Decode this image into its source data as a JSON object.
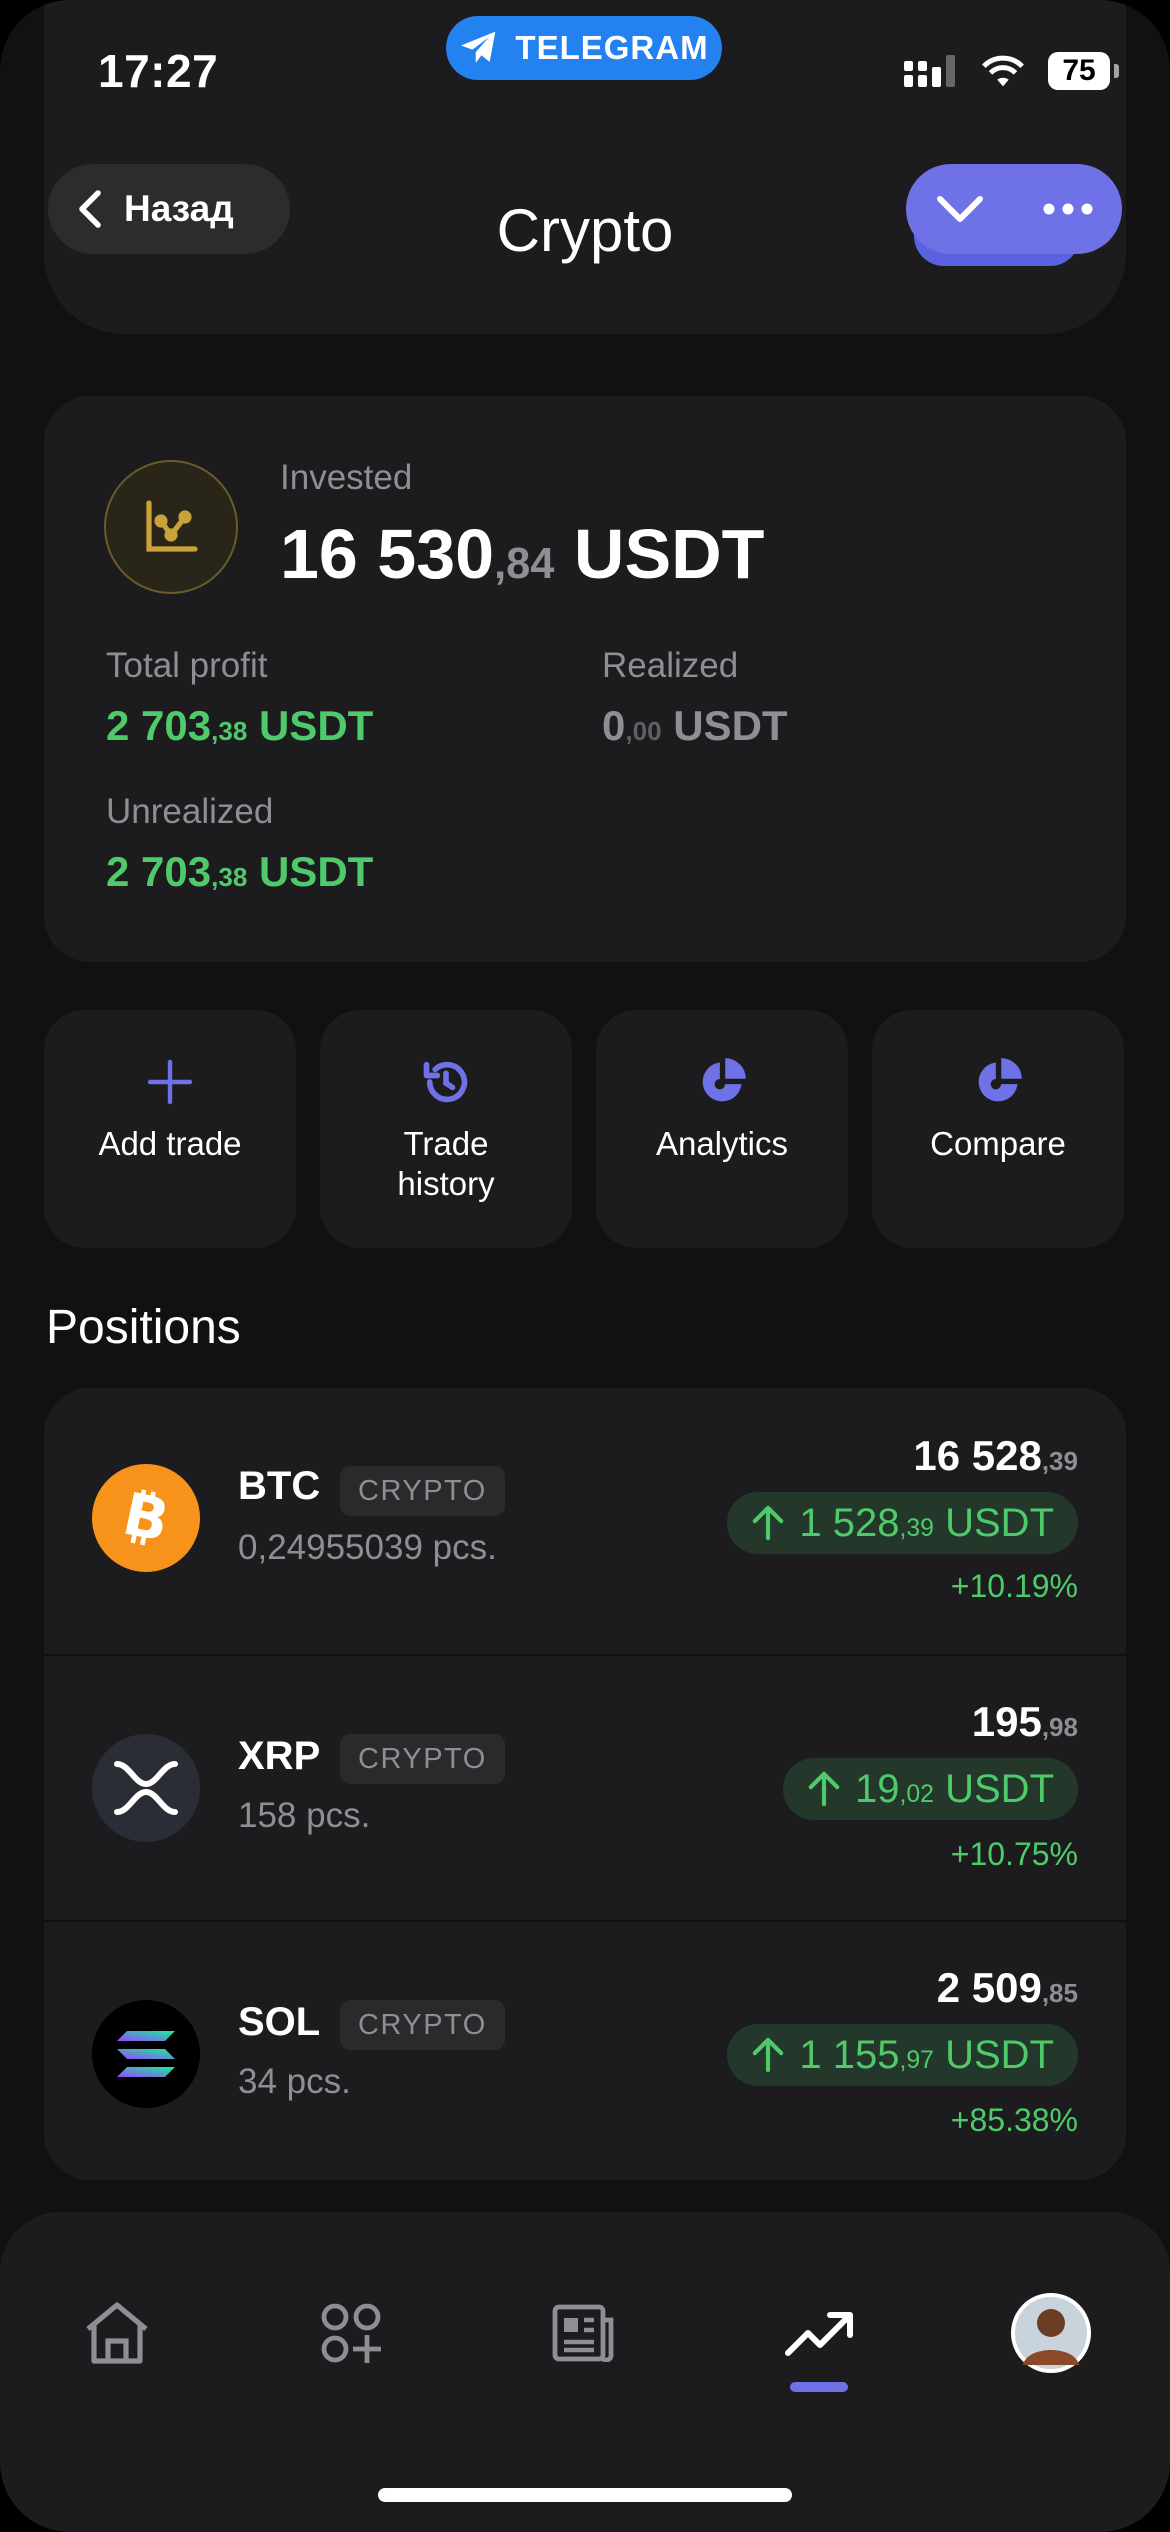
{
  "status_bar": {
    "time": "17:27",
    "battery": "75",
    "telegram_label": "TELEGRAM"
  },
  "header": {
    "back_label": "Назад",
    "title": "Crypto"
  },
  "invested": {
    "label": "Invested",
    "value_int": "16 530",
    "value_dec": ",84",
    "currency": "USDT",
    "total_profit": {
      "label": "Total profit",
      "int": "2 703",
      "dec": ",38",
      "currency": "USDT"
    },
    "realized": {
      "label": "Realized",
      "int": "0",
      "dec": ",00",
      "currency": "USDT"
    },
    "unrealized": {
      "label": "Unrealized",
      "int": "2 703",
      "dec": ",38",
      "currency": "USDT"
    }
  },
  "actions": [
    {
      "label": "Add trade",
      "icon": "plus-icon"
    },
    {
      "label": "Trade\nhistory",
      "icon": "history-icon"
    },
    {
      "label": "Analytics",
      "icon": "pie-chart-icon"
    },
    {
      "label": "Compare",
      "icon": "pie-chart-icon"
    }
  ],
  "positions_title": "Positions",
  "positions": [
    {
      "ticker": "BTC",
      "badge": "CRYPTO",
      "qty": "0,24955039 pcs.",
      "price_int": "16 528",
      "price_dec": ",39",
      "gain_int": "1 528",
      "gain_dec": ",39",
      "gain_currency": "USDT",
      "pct": "+10.19%"
    },
    {
      "ticker": "XRP",
      "badge": "CRYPTO",
      "qty": "158 pcs.",
      "price_int": "195",
      "price_dec": ",98",
      "gain_int": "19",
      "gain_dec": ",02",
      "gain_currency": "USDT",
      "pct": "+10.75%"
    },
    {
      "ticker": "SOL",
      "badge": "CRYPTO",
      "qty": "34 pcs.",
      "price_int": "2 509",
      "price_dec": ",85",
      "gain_int": "1 155",
      "gain_dec": ",97",
      "gain_currency": "USDT",
      "pct": "+85.38%"
    }
  ],
  "tabbar": {
    "items": [
      "home-icon",
      "apps-icon",
      "news-icon",
      "trending-icon",
      "avatar"
    ],
    "active": "trending-icon"
  },
  "colors": {
    "accent": "#6f72e6",
    "positive": "#4fca6b",
    "card": "#1c1c1e",
    "telegram": "#2481f0",
    "btc": "#f7931a"
  }
}
